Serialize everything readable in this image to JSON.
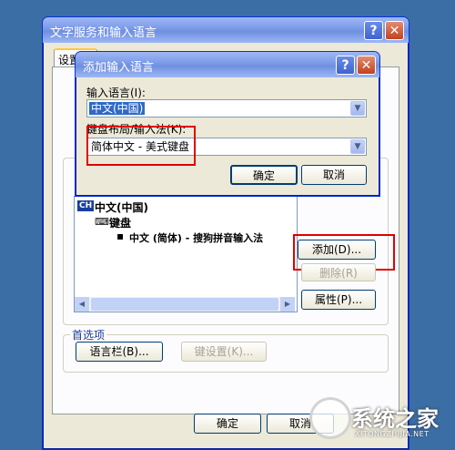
{
  "main_window": {
    "title": "文字服务和输入语言",
    "tab_settings": "设置",
    "installed_list": {
      "language": "中文(中国)",
      "lang_badge": "CH",
      "group": "键盘",
      "item": "中文 (简体) - 搜狗拼音输入法"
    },
    "add_button": "添加(D)...",
    "remove_button": "删除(R)",
    "properties_button": "属性(P)...",
    "preferences_label": "首选项",
    "language_bar_button": "语言栏(B)...",
    "key_settings_button": "键设置(K)...",
    "ok_button": "确定",
    "cancel_button": "取消"
  },
  "dialog": {
    "title": "添加输入语言",
    "input_language_label": "输入语言(I):",
    "input_language_value": "中文(中国)",
    "keyboard_layout_label": "键盘布局/输入法(K):",
    "keyboard_layout_value": "简体中文 - 美式键盘",
    "ok_button": "确定",
    "cancel_button": "取消"
  },
  "watermark": {
    "brand": "系统之家",
    "url": "XITONGZHIJIA.NET"
  },
  "colors": {
    "desktop": "#3b6ea5",
    "highlight": "#316ac5",
    "annotation_red": "#e00000"
  }
}
